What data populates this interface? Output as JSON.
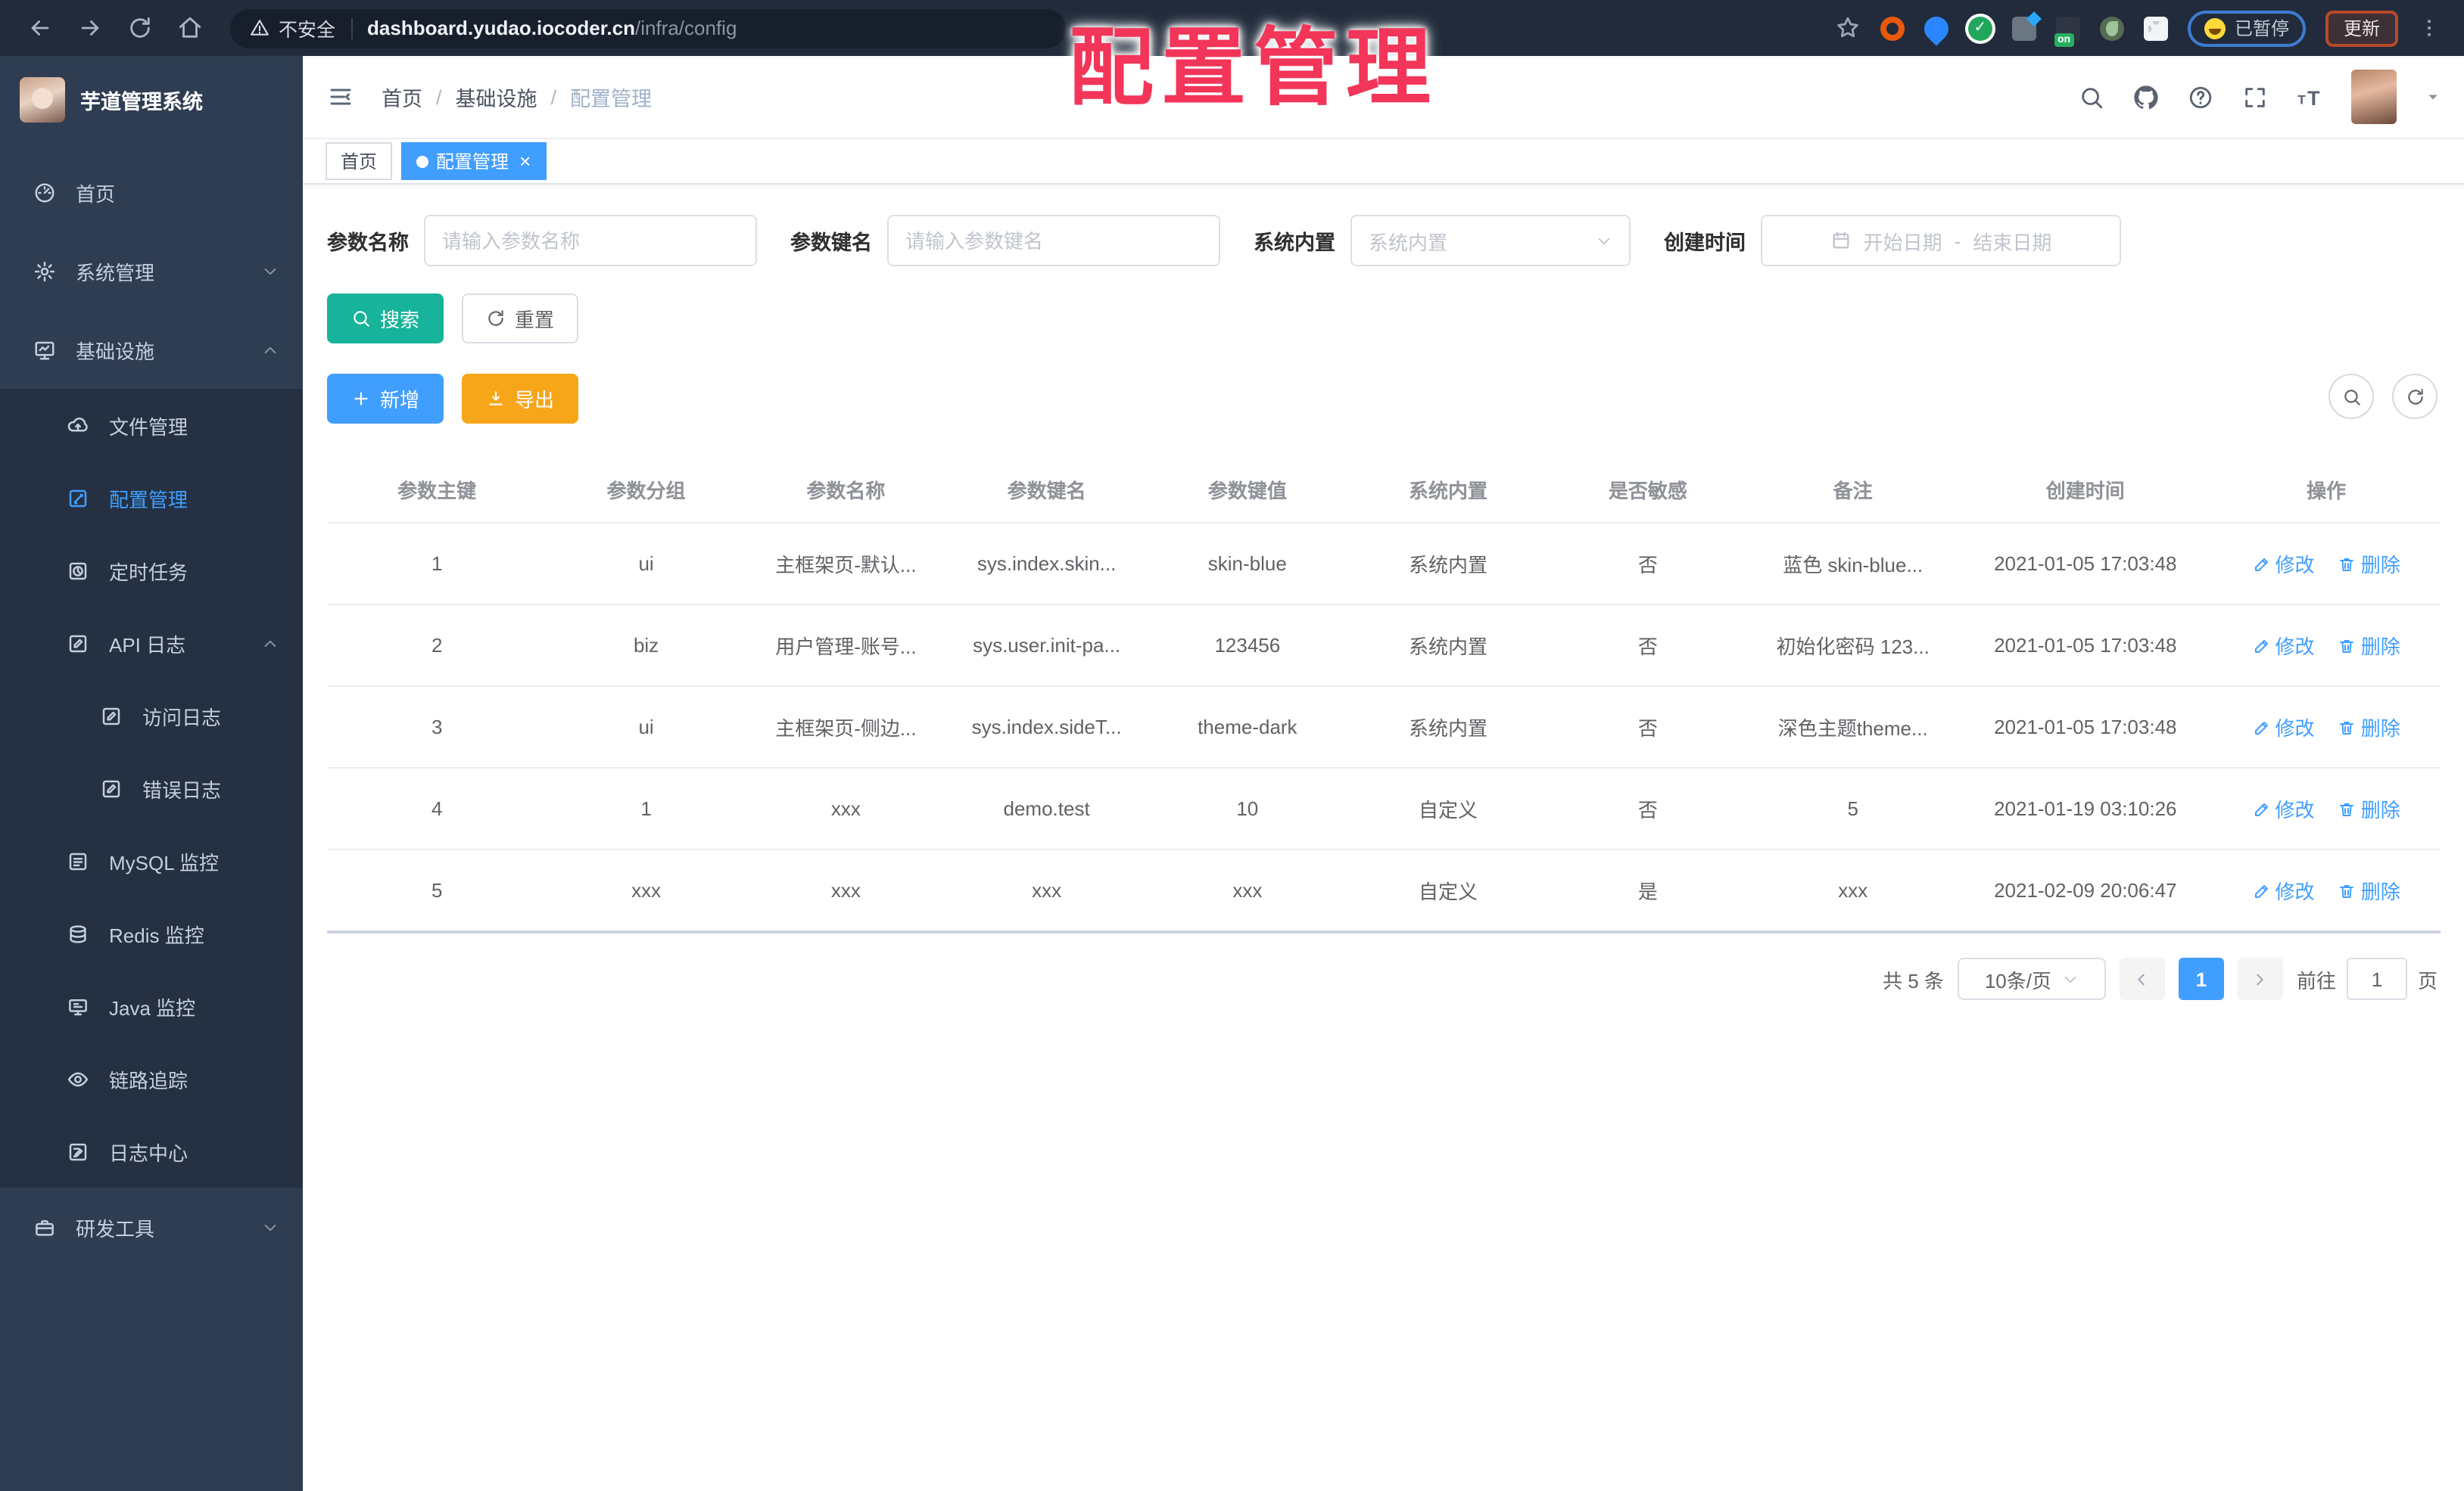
{
  "browser": {
    "security_label": "不安全",
    "url_host": "dashboard.yudao.iocoder.cn",
    "url_path": "/infra/config",
    "paused_label": "已暂停",
    "update_label": "更新"
  },
  "annotation": {
    "text": "配置管理"
  },
  "sidebar": {
    "title": "芋道管理系统",
    "items": [
      {
        "label": "首页",
        "icon": "dashboard-icon",
        "level": 1
      },
      {
        "label": "系统管理",
        "icon": "gear-icon",
        "level": 1,
        "chevron": "down"
      },
      {
        "label": "基础设施",
        "icon": "infra-monitor-icon",
        "level": 1,
        "chevron": "up"
      },
      {
        "label": "文件管理",
        "icon": "cloud-upload-icon",
        "level": 2
      },
      {
        "label": "配置管理",
        "icon": "edit-square-icon",
        "level": 2,
        "active": true
      },
      {
        "label": "定时任务",
        "icon": "timer-icon",
        "level": 2
      },
      {
        "label": "API 日志",
        "icon": "log-edit-icon",
        "level": 2,
        "chevron": "up"
      },
      {
        "label": "访问日志",
        "icon": "log-edit-icon",
        "level": 3
      },
      {
        "label": "错误日志",
        "icon": "log-edit-icon",
        "level": 3
      },
      {
        "label": "MySQL 监控",
        "icon": "mysql-icon",
        "level": 2
      },
      {
        "label": "Redis 监控",
        "icon": "redis-icon",
        "level": 2
      },
      {
        "label": "Java 监控",
        "icon": "java-monitor-icon",
        "level": 2
      },
      {
        "label": "链路追踪",
        "icon": "eye-icon",
        "level": 2
      },
      {
        "label": "日志中心",
        "icon": "log-center-icon",
        "level": 2
      },
      {
        "label": "研发工具",
        "icon": "toolbox-icon",
        "level": 1,
        "chevron": "down"
      }
    ]
  },
  "header": {
    "breadcrumb": [
      "首页",
      "基础设施",
      "配置管理"
    ]
  },
  "tags": [
    {
      "label": "首页",
      "active": false
    },
    {
      "label": "配置管理",
      "active": true,
      "closable": true
    }
  ],
  "filters": {
    "name_label": "参数名称",
    "name_placeholder": "请输入参数名称",
    "key_label": "参数键名",
    "key_placeholder": "请输入参数键名",
    "type_label": "系统内置",
    "type_placeholder": "系统内置",
    "date_label": "创建时间",
    "date_start_placeholder": "开始日期",
    "date_separator": "-",
    "date_end_placeholder": "结束日期"
  },
  "toolbar": {
    "search": "搜索",
    "reset": "重置",
    "add": "新增",
    "export": "导出"
  },
  "table": {
    "columns": [
      "参数主键",
      "参数分组",
      "参数名称",
      "参数键名",
      "参数键值",
      "系统内置",
      "是否敏感",
      "备注",
      "创建时间",
      "操作"
    ],
    "op_edit": "修改",
    "op_delete": "删除",
    "rows": [
      [
        "1",
        "ui",
        "主框架页-默认...",
        "sys.index.skin...",
        "skin-blue",
        "系统内置",
        "否",
        "蓝色 skin-blue...",
        "2021-01-05 17:03:48"
      ],
      [
        "2",
        "biz",
        "用户管理-账号...",
        "sys.user.init-pa...",
        "123456",
        "系统内置",
        "否",
        "初始化密码 123...",
        "2021-01-05 17:03:48"
      ],
      [
        "3",
        "ui",
        "主框架页-侧边...",
        "sys.index.sideT...",
        "theme-dark",
        "系统内置",
        "否",
        "深色主题theme...",
        "2021-01-05 17:03:48"
      ],
      [
        "4",
        "1",
        "xxx",
        "demo.test",
        "10",
        "自定义",
        "否",
        "5",
        "2021-01-19 03:10:26"
      ],
      [
        "5",
        "xxx",
        "xxx",
        "xxx",
        "xxx",
        "自定义",
        "是",
        "xxx",
        "2021-02-09 20:06:47"
      ]
    ]
  },
  "pagination": {
    "total": "共 5 条",
    "page_size": "10条/页",
    "current": "1",
    "goto_label": "前往",
    "goto_value": "1",
    "page_label": "页"
  },
  "colors": {
    "primary": "#409eff",
    "search_teal": "#17b39a",
    "export_orange": "#f7a61a",
    "sidebar_bg": "#2f3d52",
    "submenu_bg": "#253143",
    "annotation_red": "#f23558"
  }
}
